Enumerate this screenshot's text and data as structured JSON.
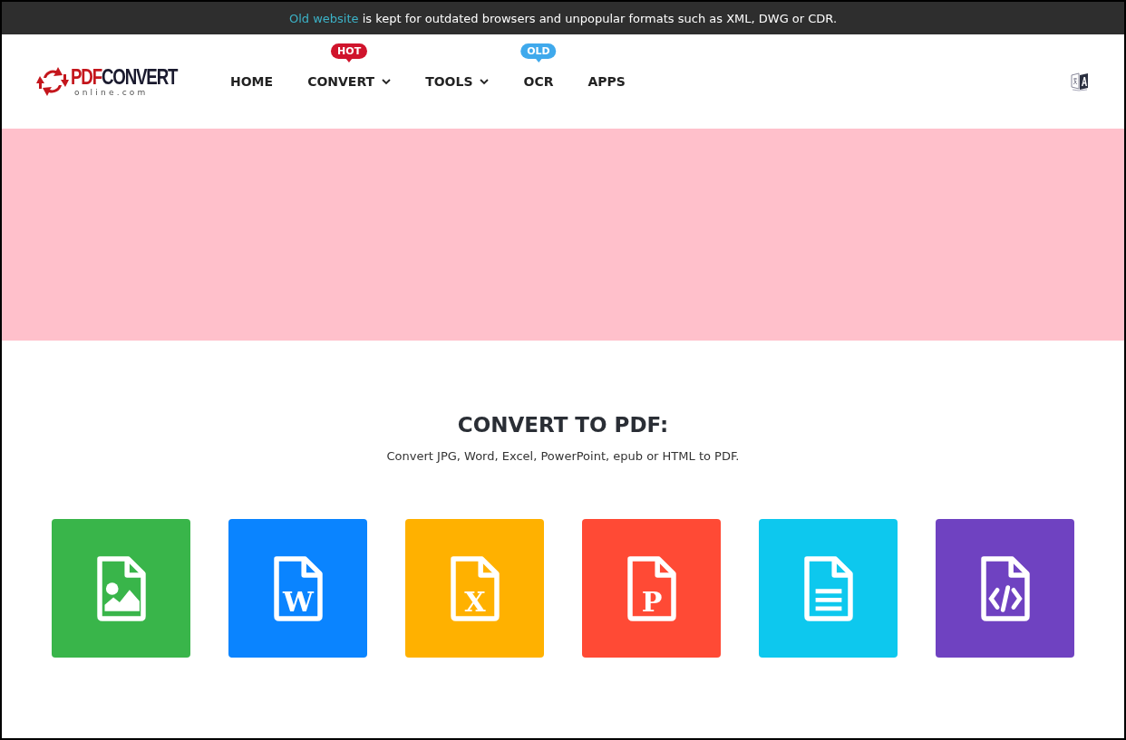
{
  "notice": {
    "link": "Old website",
    "text": "is kept for outdated browsers and unpopular formats such as XML, DWG or CDR."
  },
  "logo": {
    "first": "PDF",
    "second": "CONVERT",
    "domain": "online.com"
  },
  "nav": [
    {
      "label": "HOME",
      "dropdown": false
    },
    {
      "label": "CONVERT",
      "dropdown": true,
      "badge": {
        "text": "HOT",
        "color": "#d0142c"
      }
    },
    {
      "label": "TOOLS",
      "dropdown": true
    },
    {
      "label": "OCR",
      "dropdown": false,
      "badge": {
        "text": "OLD",
        "color": "#3fa9ec"
      }
    },
    {
      "label": "APPS",
      "dropdown": false
    }
  ],
  "banner": {
    "kind": "ad"
  },
  "section": {
    "title": "CONVERT TO PDF:",
    "subtitle": "Convert JPG, Word, Excel, PowerPoint, epub or HTML to PDF."
  },
  "tiles": [
    {
      "kind": "image",
      "color": "#39b54a"
    },
    {
      "kind": "letter",
      "letter": "W",
      "color": "#0a84ff"
    },
    {
      "kind": "letter",
      "letter": "X",
      "color": "#ffb100"
    },
    {
      "kind": "letter",
      "letter": "P",
      "color": "#ff4a35"
    },
    {
      "kind": "lines",
      "color": "#0dc8ee"
    },
    {
      "kind": "code",
      "color": "#6f42c1"
    }
  ]
}
